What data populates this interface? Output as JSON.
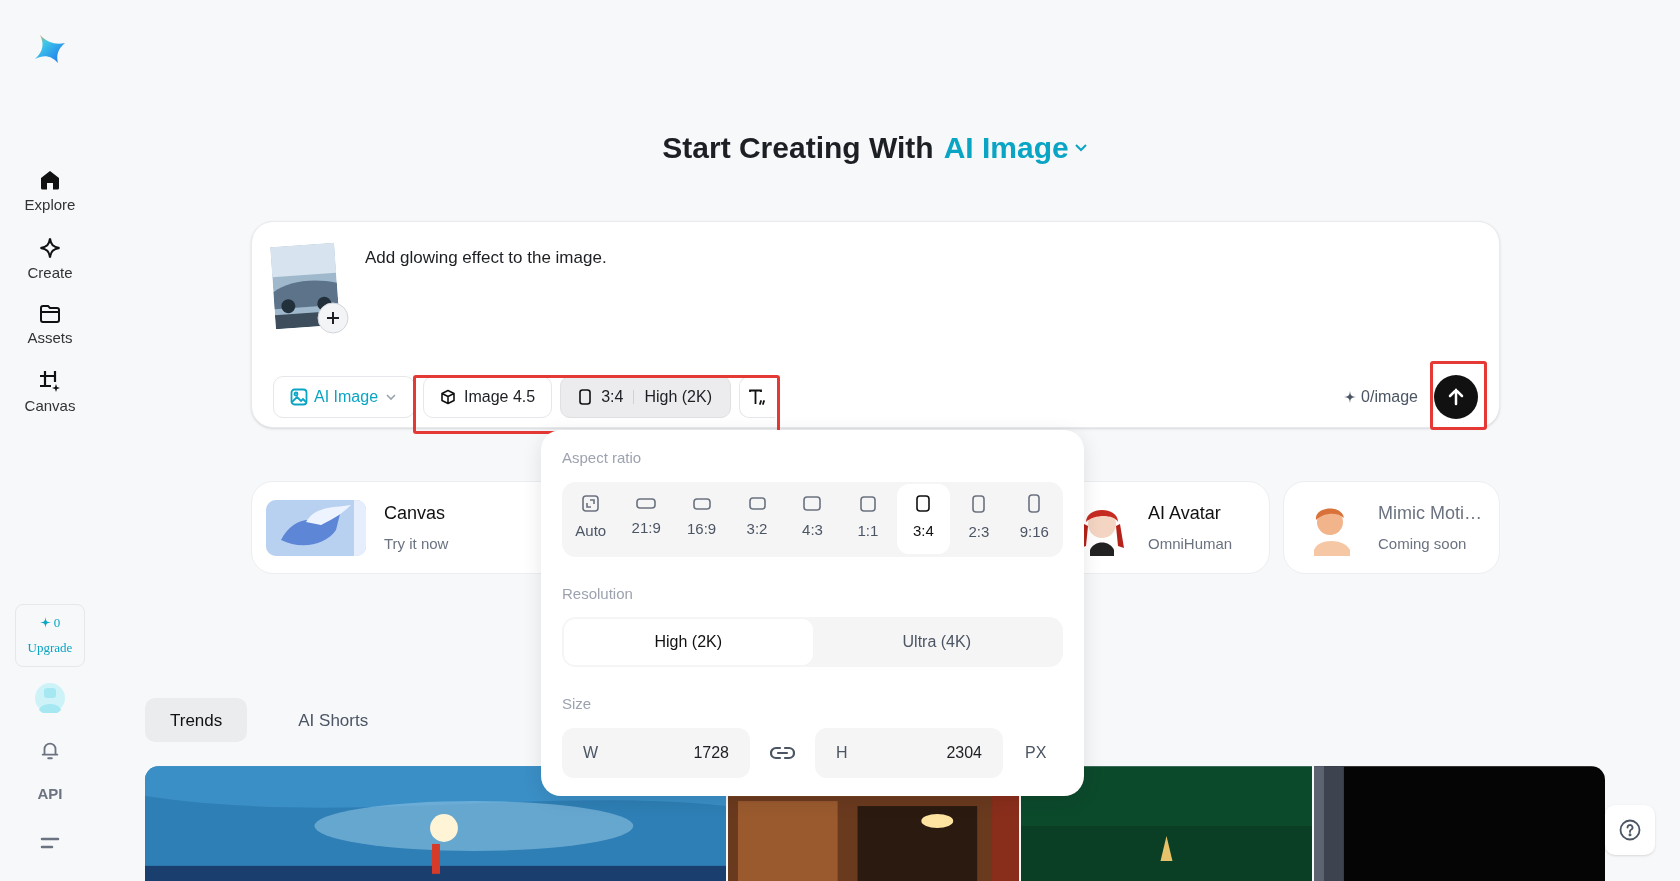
{
  "sidebar": {
    "items": [
      {
        "kind": "home",
        "label": "Explore"
      },
      {
        "kind": "create",
        "label": "Create"
      },
      {
        "kind": "assets",
        "label": "Assets"
      },
      {
        "kind": "canvas",
        "label": "Canvas"
      }
    ]
  },
  "credits": {
    "count": "0",
    "label": "Upgrade"
  },
  "sidebar_bottom": {
    "api": "API"
  },
  "heading": {
    "text": "Start Creating With",
    "mode": "AI Image"
  },
  "prompt": {
    "value": "Add glowing effect to the image."
  },
  "toolbar": [
    {
      "kind": "mode",
      "label": "AI Image"
    },
    {
      "kind": "model",
      "label": "Image 4.5"
    },
    {
      "kind": "ratio",
      "ratio": "3:4",
      "resolution": "High (2K)",
      "open": true
    },
    {
      "kind": "text-style"
    }
  ],
  "cost": "0/image",
  "popover": {
    "aspect_label": "Aspect ratio",
    "ratios": [
      {
        "kind": "auto",
        "label": "Auto",
        "selected": false
      },
      {
        "kind": "ratio",
        "label": "21:9",
        "selected": false
      },
      {
        "kind": "ratio",
        "label": "16:9",
        "selected": false
      },
      {
        "kind": "ratio",
        "label": "3:2",
        "selected": false
      },
      {
        "kind": "ratio",
        "label": "4:3",
        "selected": false
      },
      {
        "kind": "ratio",
        "label": "1:1",
        "selected": false
      },
      {
        "kind": "ratio",
        "label": "3:4",
        "selected": true
      },
      {
        "kind": "ratio",
        "label": "2:3",
        "selected": false
      },
      {
        "kind": "ratio",
        "label": "9:16",
        "selected": false
      }
    ],
    "resolution_label": "Resolution",
    "resolutions": [
      {
        "label": "High (2K)",
        "selected": true
      },
      {
        "label": "Ultra (4K)",
        "selected": false
      }
    ],
    "size_label": "Size",
    "width": {
      "label": "W",
      "value": "1728"
    },
    "height": {
      "label": "H",
      "value": "2304"
    },
    "unit": "PX"
  },
  "cards": [
    {
      "title": "Canvas",
      "subtitle": "Try it now",
      "disabled": false
    },
    {
      "title": "AI Avatar",
      "subtitle": "OmniHuman",
      "disabled": false
    },
    {
      "title": "Mimic Moti…",
      "subtitle": "Coming soon",
      "disabled": true
    }
  ],
  "feed_tabs": [
    {
      "label": "Trends",
      "selected": true
    },
    {
      "label": "AI Shorts",
      "selected": false
    }
  ]
}
